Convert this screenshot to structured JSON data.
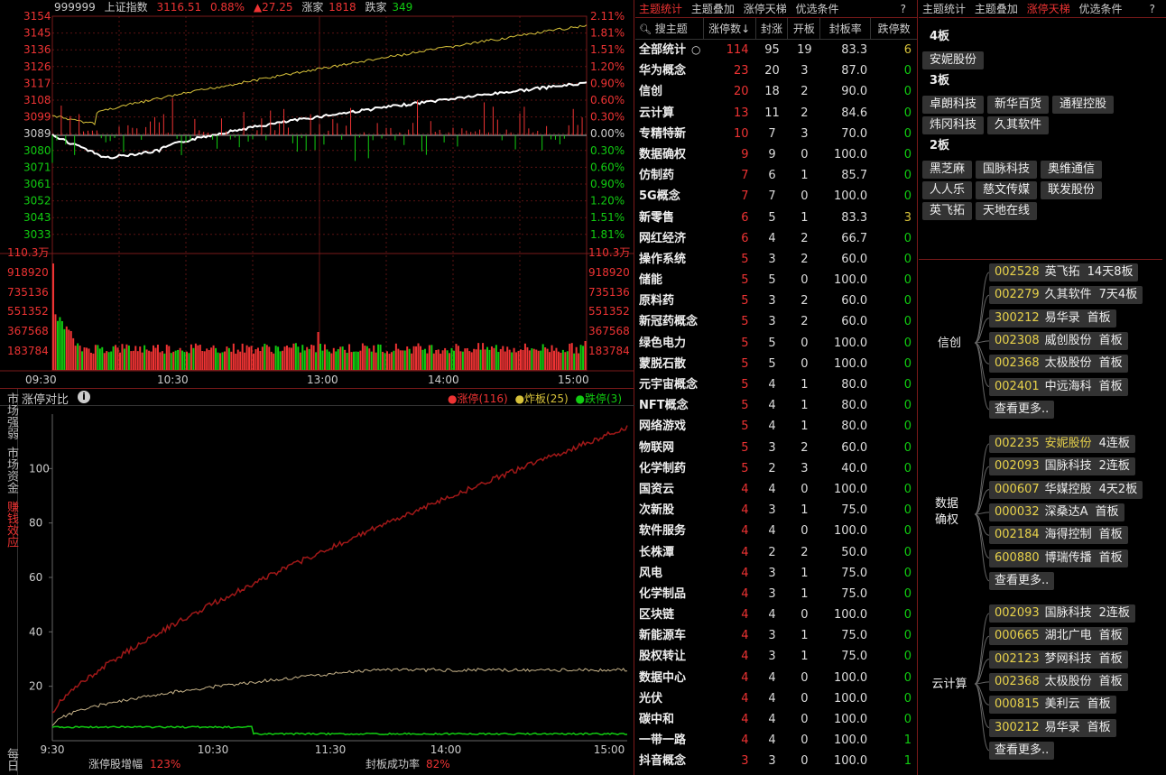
{
  "index_header": {
    "code": "999999",
    "name": "上证指数",
    "price": "3116.51",
    "pct": "0.88%",
    "change": "▲27.25",
    "up_label": "涨家",
    "up_count": "1818",
    "down_label": "跌家",
    "down_count": "349"
  },
  "price_axis_left": [
    "3154",
    "3145",
    "3136",
    "3126",
    "3117",
    "3108",
    "3099",
    "3089",
    "3080",
    "3071",
    "3061",
    "3052",
    "3043",
    "3033"
  ],
  "pct_axis_right": [
    "2.11%",
    "1.81%",
    "1.51%",
    "1.20%",
    "0.90%",
    "0.60%",
    "0.30%",
    "0.00%",
    "0.30%",
    "0.60%",
    "0.90%",
    "1.20%",
    "1.51%",
    "1.81%"
  ],
  "vol_axis": [
    "110.3万",
    "918920",
    "735136",
    "551352",
    "367568",
    "183784"
  ],
  "time_axis": [
    "09:30",
    "10:30",
    "13:00",
    "14:00",
    "15:00"
  ],
  "compare": {
    "title": "涨停对比",
    "legend": [
      {
        "label": "涨停(116)",
        "color": "#e33"
      },
      {
        "label": "炸板(25)",
        "color": "#d7c23a"
      },
      {
        "label": "跌停(3)",
        "color": "#1c1"
      }
    ],
    "y_ticks": [
      "100",
      "80",
      "60",
      "40",
      "20"
    ],
    "x_ticks": [
      "9:30",
      "10:30",
      "11:30",
      "14:00",
      "15:00"
    ],
    "footer_a_label": "涨停股增幅",
    "footer_a_val": "123%",
    "footer_b_label": "封板成功率",
    "footer_b_val": "82%"
  },
  "side_tabs": [
    "市场强弱",
    "市场资金",
    "赚钱效应",
    "每日"
  ],
  "mid_tabs": [
    "主题统计",
    "主题叠加",
    "涨停天梯",
    "优选条件"
  ],
  "right_tabs": [
    "主题统计",
    "主题叠加",
    "涨停天梯",
    "优选条件"
  ],
  "help": "?",
  "table": {
    "search": "搜主题",
    "headers": [
      "涨停数↓",
      "封涨",
      "开板",
      "封板率",
      "跌停数"
    ],
    "rows": [
      [
        "全部统计",
        "114",
        "95",
        "19",
        "83.3",
        "6"
      ],
      [
        "华为概念",
        "23",
        "20",
        "3",
        "87.0",
        "0"
      ],
      [
        "信创",
        "20",
        "18",
        "2",
        "90.0",
        "0"
      ],
      [
        "云计算",
        "13",
        "11",
        "2",
        "84.6",
        "0"
      ],
      [
        "专精特新",
        "10",
        "7",
        "3",
        "70.0",
        "0"
      ],
      [
        "数据确权",
        "9",
        "9",
        "0",
        "100.0",
        "0"
      ],
      [
        "仿制药",
        "7",
        "6",
        "1",
        "85.7",
        "0"
      ],
      [
        "5G概念",
        "7",
        "7",
        "0",
        "100.0",
        "0"
      ],
      [
        "新零售",
        "6",
        "5",
        "1",
        "83.3",
        "3"
      ],
      [
        "网红经济",
        "6",
        "4",
        "2",
        "66.7",
        "0"
      ],
      [
        "操作系统",
        "5",
        "3",
        "2",
        "60.0",
        "0"
      ],
      [
        "储能",
        "5",
        "5",
        "0",
        "100.0",
        "0"
      ],
      [
        "原料药",
        "5",
        "3",
        "2",
        "60.0",
        "0"
      ],
      [
        "新冠药概念",
        "5",
        "3",
        "2",
        "60.0",
        "0"
      ],
      [
        "绿色电力",
        "5",
        "5",
        "0",
        "100.0",
        "0"
      ],
      [
        "蒙脱石散",
        "5",
        "5",
        "0",
        "100.0",
        "0"
      ],
      [
        "元宇宙概念",
        "5",
        "4",
        "1",
        "80.0",
        "0"
      ],
      [
        "NFT概念",
        "5",
        "4",
        "1",
        "80.0",
        "0"
      ],
      [
        "网络游戏",
        "5",
        "4",
        "1",
        "80.0",
        "0"
      ],
      [
        "物联网",
        "5",
        "3",
        "2",
        "60.0",
        "0"
      ],
      [
        "化学制药",
        "5",
        "2",
        "3",
        "40.0",
        "0"
      ],
      [
        "国资云",
        "4",
        "4",
        "0",
        "100.0",
        "0"
      ],
      [
        "次新股",
        "4",
        "3",
        "1",
        "75.0",
        "0"
      ],
      [
        "软件服务",
        "4",
        "4",
        "0",
        "100.0",
        "0"
      ],
      [
        "长株潭",
        "4",
        "2",
        "2",
        "50.0",
        "0"
      ],
      [
        "风电",
        "4",
        "3",
        "1",
        "75.0",
        "0"
      ],
      [
        "化学制品",
        "4",
        "3",
        "1",
        "75.0",
        "0"
      ],
      [
        "区块链",
        "4",
        "4",
        "0",
        "100.0",
        "0"
      ],
      [
        "新能源车",
        "4",
        "3",
        "1",
        "75.0",
        "0"
      ],
      [
        "股权转让",
        "4",
        "3",
        "1",
        "75.0",
        "0"
      ],
      [
        "数据中心",
        "4",
        "4",
        "0",
        "100.0",
        "0"
      ],
      [
        "光伏",
        "4",
        "4",
        "0",
        "100.0",
        "0"
      ],
      [
        "碳中和",
        "4",
        "4",
        "0",
        "100.0",
        "0"
      ],
      [
        "一带一路",
        "4",
        "4",
        "0",
        "100.0",
        "1"
      ],
      [
        "抖音概念",
        "3",
        "3",
        "0",
        "100.0",
        "1"
      ]
    ]
  },
  "ladder": [
    {
      "level": "4板",
      "stocks": [
        "安妮股份"
      ]
    },
    {
      "level": "3板",
      "stocks": [
        "卓朗科技",
        "新华百货",
        "通程控股",
        "炜冈科技",
        "久其软件"
      ]
    },
    {
      "level": "2板",
      "stocks": [
        "黑芝麻",
        "国脉科技",
        "奥维通信",
        "人人乐",
        "慈文传媒",
        "联发股份",
        "英飞拓",
        "天地在线"
      ]
    }
  ],
  "groups": [
    {
      "name": "信创",
      "items": [
        [
          "002528",
          "英飞拓",
          "14天8板"
        ],
        [
          "002279",
          "久其软件",
          "7天4板"
        ],
        [
          "300212",
          "易华录",
          "首板"
        ],
        [
          "002308",
          "威创股份",
          "首板"
        ],
        [
          "002368",
          "太极股份",
          "首板"
        ],
        [
          "002401",
          "中远海科",
          "首板"
        ]
      ],
      "more": "查看更多.."
    },
    {
      "name": "数据确权",
      "items": [
        [
          "002235",
          "安妮股份",
          "4连板"
        ],
        [
          "002093",
          "国脉科技",
          "2连板"
        ],
        [
          "000607",
          "华媒控股",
          "4天2板"
        ],
        [
          "000032",
          "深桑达A",
          "首板"
        ],
        [
          "002184",
          "海得控制",
          "首板"
        ],
        [
          "600880",
          "博瑞传播",
          "首板"
        ]
      ],
      "more": "查看更多.."
    },
    {
      "name": "云计算",
      "items": [
        [
          "002093",
          "国脉科技",
          "2连板"
        ],
        [
          "000665",
          "湖北广电",
          "首板"
        ],
        [
          "002123",
          "梦网科技",
          "首板"
        ],
        [
          "002368",
          "太极股份",
          "首板"
        ],
        [
          "000815",
          "美利云",
          "首板"
        ],
        [
          "300212",
          "易华录",
          "首板"
        ]
      ],
      "more": "查看更多.."
    }
  ]
}
